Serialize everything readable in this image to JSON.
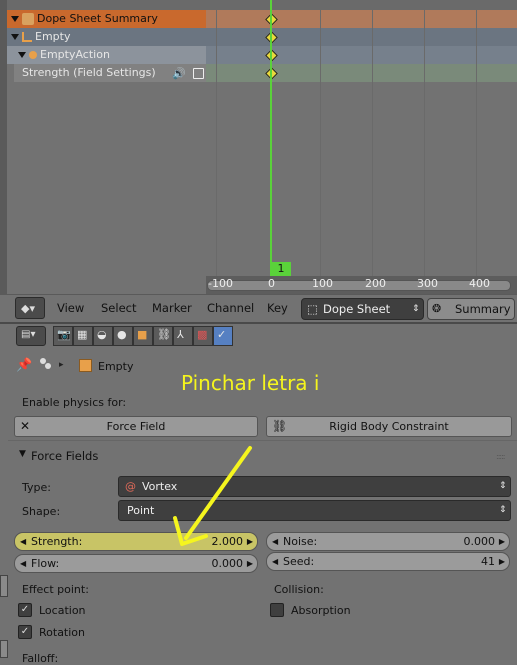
{
  "dope_sheet": {
    "channels": [
      {
        "label": "Dope Sheet Summary",
        "icon": "dope-sheet-icon"
      },
      {
        "label": "Empty",
        "icon": "empty-object-icon"
      },
      {
        "label": "EmptyAction",
        "icon": "action-icon"
      },
      {
        "label": "Strength (Field Settings)",
        "icon": "fcurve-icon"
      }
    ],
    "current_frame": "1",
    "ticks": [
      "-100",
      "0",
      "100",
      "200",
      "300",
      "400"
    ]
  },
  "header": {
    "menus": [
      "View",
      "Select",
      "Marker",
      "Channel",
      "Key"
    ],
    "mode": "Dope Sheet",
    "summary": "Summary"
  },
  "properties": {
    "breadcrumb_object": "Empty",
    "annotation": "Pinchar letra i",
    "enable_physics_label": "Enable physics for:",
    "force_field_button": "Force Field",
    "rigid_body_button": "Rigid Body Constraint",
    "panel_title": "Force Fields",
    "type_label": "Type:",
    "type_value": "Vortex",
    "shape_label": "Shape:",
    "shape_value": "Point",
    "strength_label": "Strength:",
    "strength_value": "2.000",
    "flow_label": "Flow:",
    "flow_value": "0.000",
    "noise_label": "Noise:",
    "noise_value": "0.000",
    "seed_label": "Seed:",
    "seed_value": "41",
    "effect_point_label": "Effect point:",
    "location_label": "Location",
    "rotation_label": "Rotation",
    "collision_label": "Collision:",
    "absorption_label": "Absorption",
    "falloff_label": "Falloff:"
  }
}
